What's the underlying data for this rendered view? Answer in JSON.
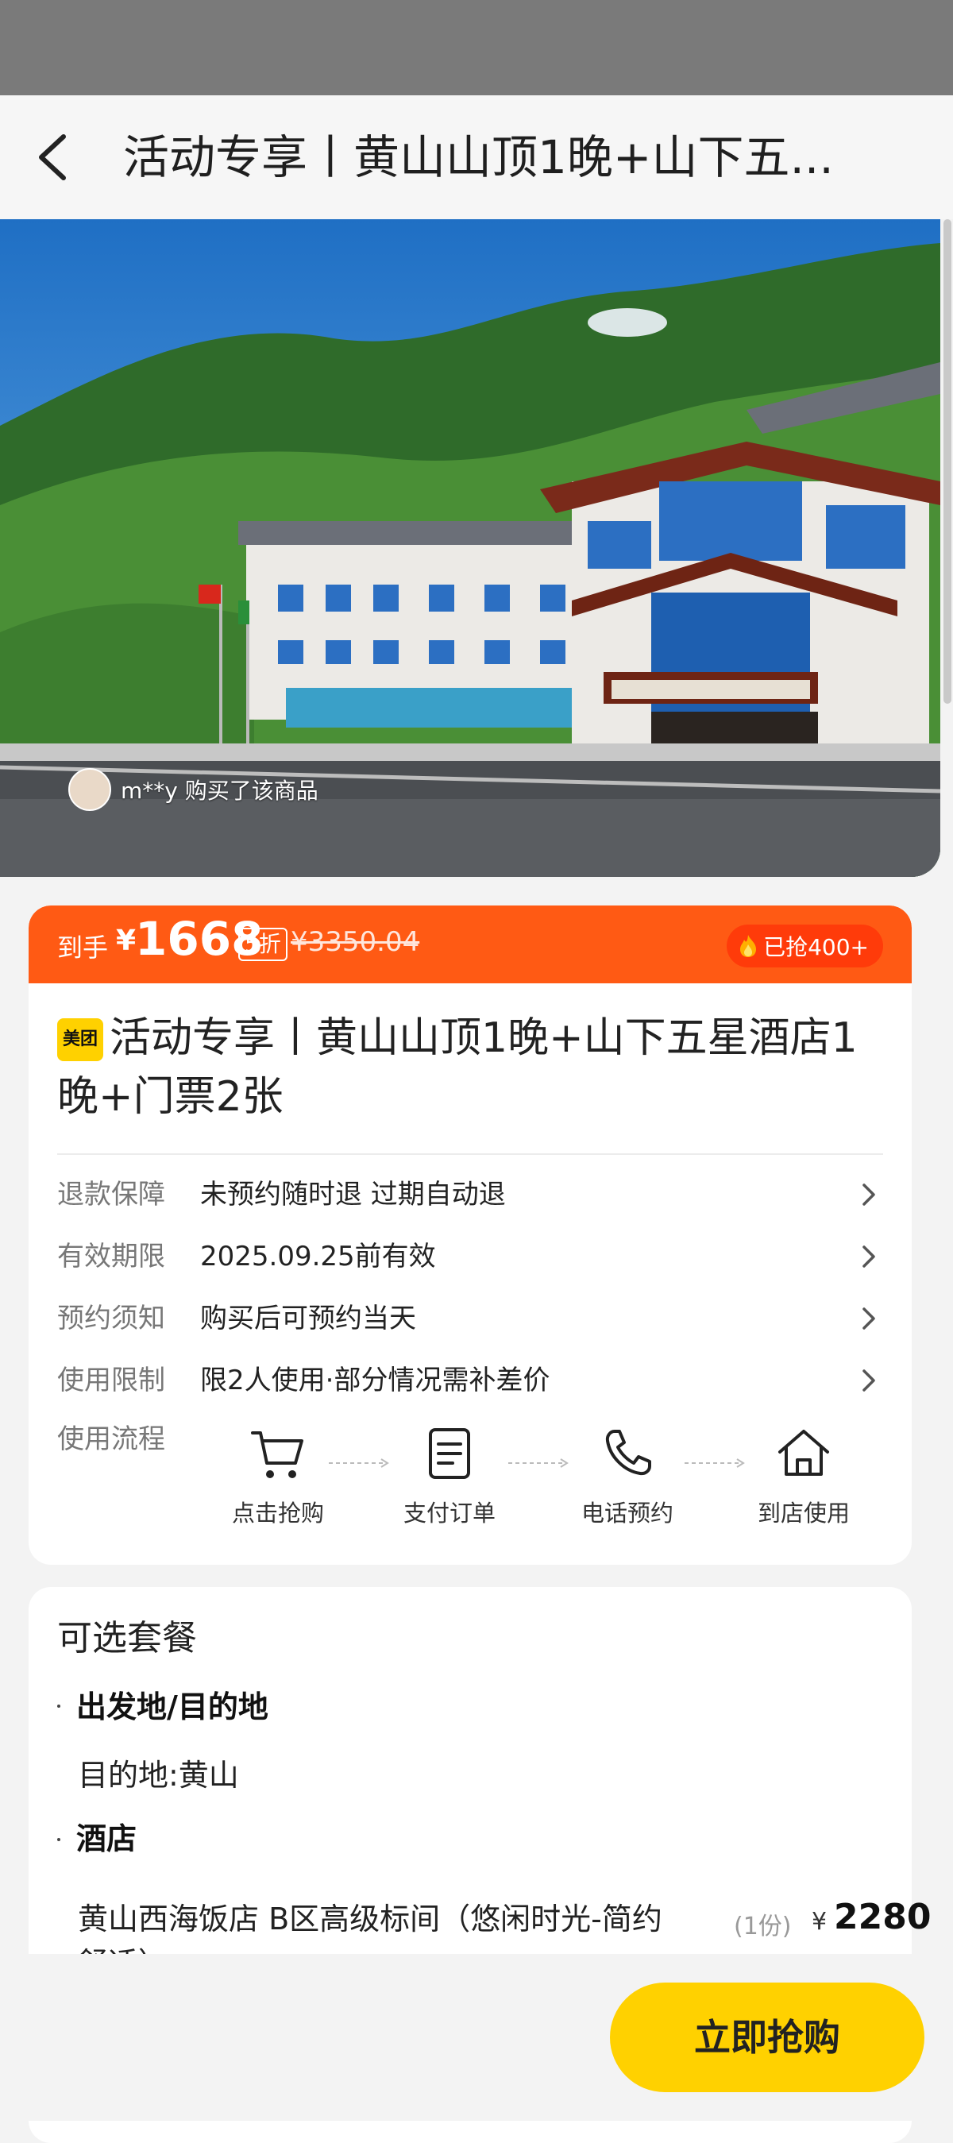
{
  "header": {
    "title": "活动专享丨黄山山顶1晚+山下五..."
  },
  "hero": {
    "buyer_text": "m**y 购买了该商品"
  },
  "price": {
    "lead": "到手",
    "yen": "¥",
    "amount": "1668",
    "discount": "5折",
    "original": "¥3350.04",
    "sold": "已抢400+"
  },
  "product": {
    "brand": "美团",
    "title": "活动专享丨黄山山顶1晚+山下五星酒店1晚+门票2张"
  },
  "info_rows": [
    {
      "label": "退款保障",
      "value": "未预约随时退 过期自动退"
    },
    {
      "label": "有效期限",
      "value": "2025.09.25前有效"
    },
    {
      "label": "预约须知",
      "value": "购买后可预约当天"
    },
    {
      "label": "使用限制",
      "value": "限2人使用·部分情况需补差价"
    }
  ],
  "flow": {
    "label": "使用流程",
    "steps": [
      {
        "label": "点击抢购",
        "icon": "cart-icon"
      },
      {
        "label": "支付订单",
        "icon": "document-icon"
      },
      {
        "label": "电话预约",
        "icon": "phone-icon"
      },
      {
        "label": "到店使用",
        "icon": "home-icon"
      }
    ]
  },
  "package": {
    "title": "可选套餐",
    "sections": [
      {
        "heading": "出发地/目的地",
        "body": "目的地:黄山"
      },
      {
        "heading": "酒店"
      }
    ],
    "room": {
      "name": "黄山西海饭店 B区高级标间（悠闲时光-简约舒适）",
      "qty": "(1份)",
      "yen": "¥",
      "price": "2280"
    }
  },
  "cta": {
    "label": "立即抢购"
  },
  "colors": {
    "accent_orange": "#ff5a14",
    "brand_yellow": "#ffd100"
  }
}
